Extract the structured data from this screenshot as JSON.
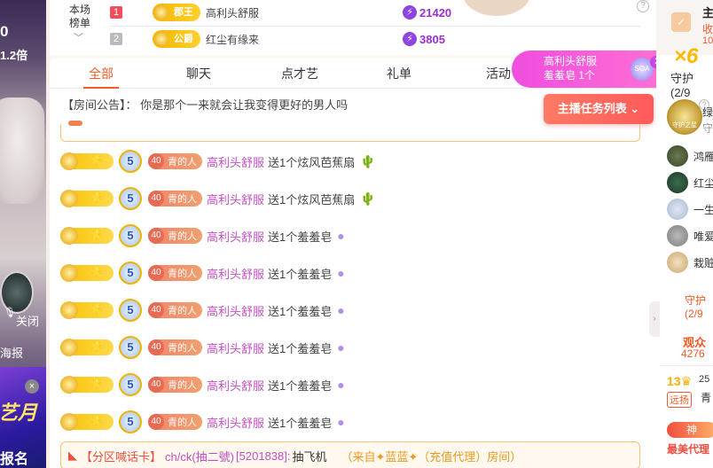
{
  "left_strip": {
    "count_text": "0",
    "rate_text": "1.2倍",
    "closed_text": "关闭",
    "poster_text": "海报",
    "promo_text": "艺月",
    "signup_text": "报名"
  },
  "rank_board": {
    "label_line1": "本场",
    "label_line2": "榜单",
    "rows": [
      {
        "rank": "1",
        "noble": "郡王",
        "name": "高利头舒服",
        "score": "21420"
      },
      {
        "rank": "2",
        "noble": "公爵",
        "name": "红尘有缘来",
        "score": "3805"
      }
    ]
  },
  "tabs": [
    {
      "label": "全部"
    },
    {
      "label": "聊天"
    },
    {
      "label": "点才艺"
    },
    {
      "label": "礼单"
    },
    {
      "label": "活动"
    }
  ],
  "notice": {
    "prefix": "【房间公告】：",
    "text": "你是那个一来就会让我变得更好的男人吗"
  },
  "gift_popup": {
    "name": "高利头舒服",
    "gift": "羞羞皂",
    "count_text": "1个",
    "bubble_count": "2",
    "bubble_label": "SOA"
  },
  "task_button": {
    "label": "主播任务列表"
  },
  "messages": [
    {
      "level": "5",
      "fan_level": "40",
      "fan_name": "青的人",
      "user": "高利头舒服",
      "text": "送1个炫风芭蕉扇"
    },
    {
      "level": "5",
      "fan_level": "40",
      "fan_name": "青的人",
      "user": "高利头舒服",
      "text": "送1个炫风芭蕉扇"
    },
    {
      "level": "5",
      "fan_level": "40",
      "fan_name": "青的人",
      "user": "高利头舒服",
      "text": "送1个羞羞皂"
    },
    {
      "level": "5",
      "fan_level": "40",
      "fan_name": "青的人",
      "user": "高利头舒服",
      "text": "送1个羞羞皂"
    },
    {
      "level": "5",
      "fan_level": "40",
      "fan_name": "青的人",
      "user": "高利头舒服",
      "text": "送1个羞羞皂"
    },
    {
      "level": "5",
      "fan_level": "40",
      "fan_name": "青的人",
      "user": "高利头舒服",
      "text": "送1个羞羞皂"
    },
    {
      "level": "5",
      "fan_level": "40",
      "fan_name": "青的人",
      "user": "高利头舒服",
      "text": "送1个羞羞皂"
    },
    {
      "level": "5",
      "fan_level": "40",
      "fan_name": "青的人",
      "user": "高利头舒服",
      "text": "送1个羞羞皂"
    }
  ],
  "shout_card": {
    "tag": "【分区喊话卡】",
    "user": "ch/ck(抽二號)",
    "uid": "[5201838]:",
    "message": "抽飞机",
    "from": "（来自✦蓝蓝✦（充值代理）房间）"
  },
  "right_panel": {
    "title": "主",
    "shou": "收",
    "ten": "10",
    "multiplier": "×6",
    "guard_tab": "守护(2/9",
    "guard_badge": "守护之星",
    "guard_list_line1": "绿",
    "guard_list_line2": "守",
    "guard_items": [
      {
        "name": "鸿雁"
      },
      {
        "name": "红尘"
      },
      {
        "name": "一生"
      },
      {
        "name": "唯爱"
      },
      {
        "name": "栽赃"
      }
    ],
    "guard_link": "守护(2/9",
    "audience_label": "观众",
    "audience_count": "4276",
    "level_text": "13",
    "level_num": "25",
    "yuanying": "远扬",
    "qing": "青",
    "shen": "神",
    "best_text": "最美代理"
  }
}
